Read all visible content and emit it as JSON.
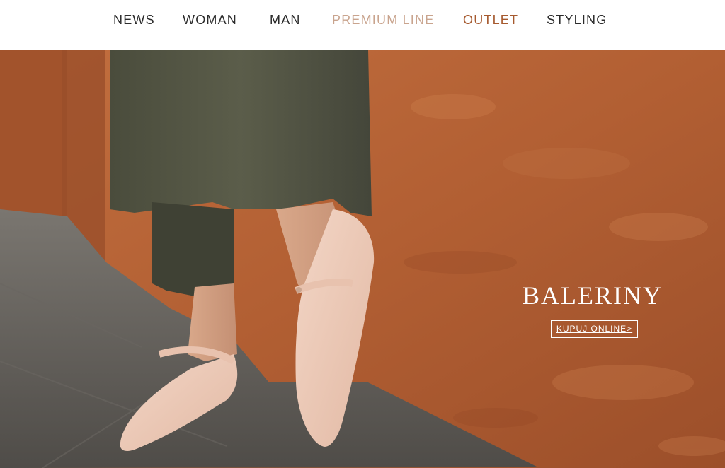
{
  "nav": {
    "items": [
      {
        "label": "NEWS"
      },
      {
        "label": "WOMAN"
      },
      {
        "label": "MAN"
      },
      {
        "label": "PREMIUM LINE"
      },
      {
        "label": "OUTLET"
      },
      {
        "label": "STYLING"
      }
    ]
  },
  "hero": {
    "title": "BALERINY",
    "cta_label": "KUPUJ ONLINE>"
  },
  "colors": {
    "premium_accent": "#c9a48e",
    "outlet_accent": "#a65a2f",
    "nav_text": "#2b2b2b",
    "hero_text": "#ffffff"
  }
}
